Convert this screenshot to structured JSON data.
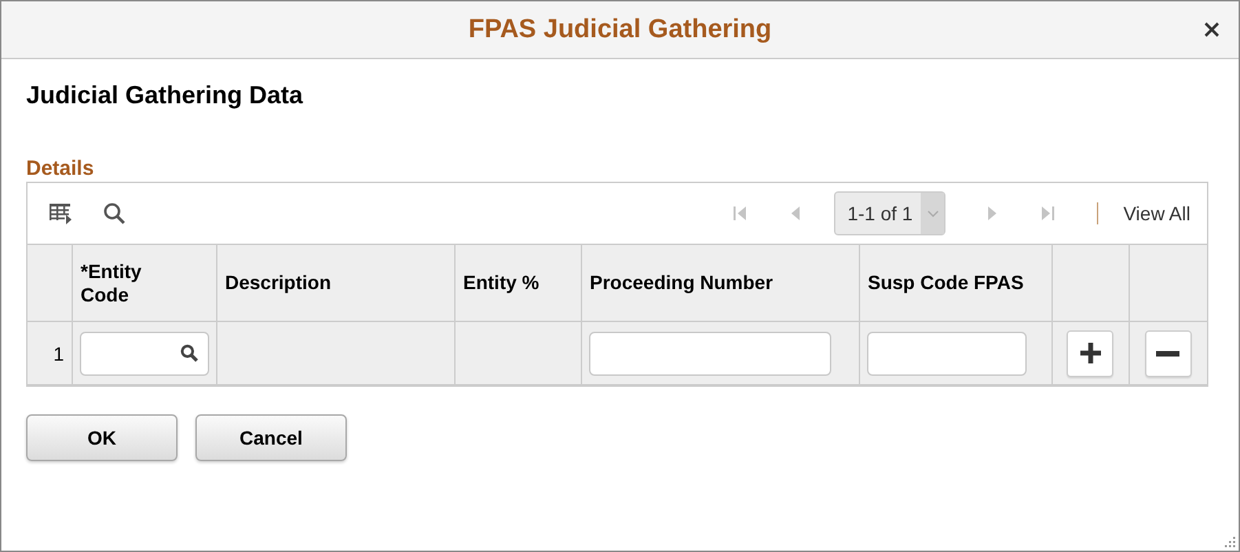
{
  "window": {
    "title": "FPAS Judicial Gathering"
  },
  "page_title": "Judicial Gathering Data",
  "section": {
    "title": "Details"
  },
  "grid_toolbar": {
    "nav": [
      {
        "kind": "first",
        "disabled": true
      },
      {
        "kind": "prev",
        "disabled": true
      },
      {
        "kind": "next",
        "disabled": true
      },
      {
        "kind": "last",
        "disabled": true
      }
    ],
    "pager": "1-1 of 1",
    "view_all": "View All"
  },
  "table": {
    "columns": [
      "*Entity\nCode",
      "Description",
      "Entity %",
      "Proceeding Number",
      "Susp Code FPAS"
    ],
    "rows": [
      {
        "row_number": "1"
      }
    ]
  },
  "buttons": [
    "OK",
    "Cancel"
  ]
}
